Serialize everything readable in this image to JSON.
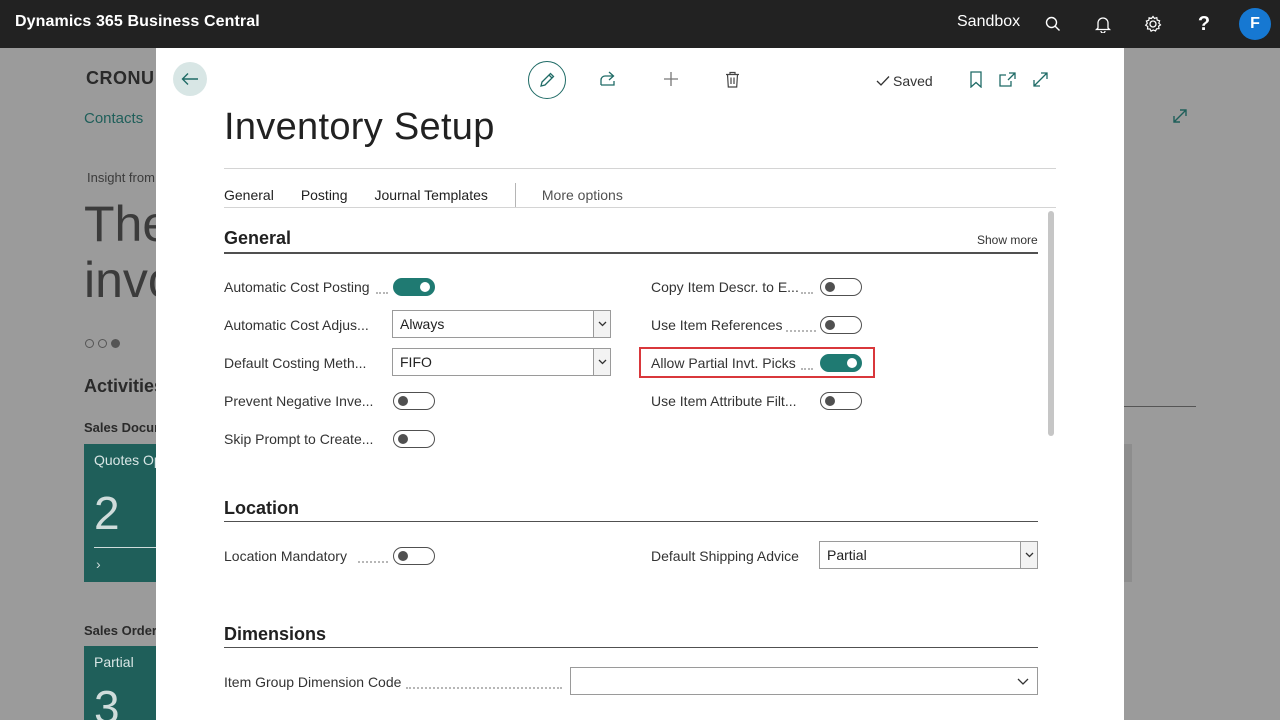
{
  "topbar": {
    "app_title": "Dynamics 365 Business Central",
    "environment": "Sandbox",
    "avatar_initial": "F",
    "icons": [
      "search-icon",
      "bell-icon",
      "gear-icon",
      "help-icon"
    ]
  },
  "background": {
    "company": "CRONU",
    "nav": "Contacts",
    "insight": "Insight from",
    "headline_line1": "The",
    "headline_line2": "invo",
    "activities": "Activities",
    "section1": "Sales Docur",
    "tile1_label": "Quotes Op",
    "tile1_value": "2",
    "section2": "Sales Order",
    "tile2_label": "Partial",
    "tile2_value": "3"
  },
  "dialog": {
    "saved_label": "Saved",
    "title": "Inventory Setup",
    "tabs": [
      "General",
      "Posting",
      "Journal Templates"
    ],
    "more_options": "More options",
    "general": {
      "title": "General",
      "show_more": "Show more",
      "left_fields": [
        {
          "label": "Automatic Cost Posting",
          "type": "toggle",
          "value": true
        },
        {
          "label": "Automatic Cost Adjus...",
          "type": "select",
          "value": "Always"
        },
        {
          "label": "Default Costing Meth...",
          "type": "select",
          "value": "FIFO"
        },
        {
          "label": "Prevent Negative Inve...",
          "type": "toggle",
          "value": false
        },
        {
          "label": "Skip Prompt to Create...",
          "type": "toggle",
          "value": false
        }
      ],
      "right_fields": [
        {
          "label": "Copy Item Descr. to E...",
          "type": "toggle",
          "value": false
        },
        {
          "label": "Use Item References",
          "type": "toggle",
          "value": false
        },
        {
          "label": "Allow Partial Invt. Picks",
          "type": "toggle",
          "value": true
        },
        {
          "label": "Use Item Attribute Filt...",
          "type": "toggle",
          "value": false
        }
      ]
    },
    "location": {
      "title": "Location",
      "location_mandatory_label": "Location Mandatory",
      "location_mandatory_value": false,
      "shipping_advice_label": "Default Shipping Advice",
      "shipping_advice_value": "Partial"
    },
    "dimensions": {
      "title": "Dimensions",
      "item_group_label": "Item Group Dimension Code",
      "item_group_value": ""
    }
  },
  "colors": {
    "accent": "#1f7a72",
    "highlight": "#d9373b",
    "topbar": "#222222",
    "avatar": "#1678d2"
  }
}
